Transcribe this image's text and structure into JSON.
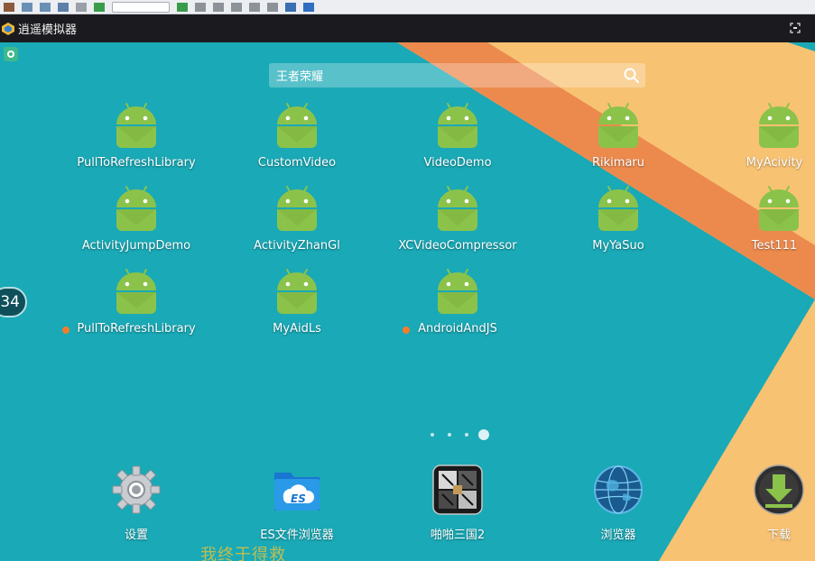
{
  "emulator": {
    "title": "逍遥模拟器",
    "fullscreen_icon": "fullscreen-icon",
    "logo_icon": "emulator-logo-icon"
  },
  "search": {
    "text": "王者荣耀",
    "icon": "search-icon"
  },
  "apps": [
    {
      "label": "PullToRefreshLibrary",
      "new": false
    },
    {
      "label": "CustomVideo",
      "new": false
    },
    {
      "label": "VideoDemo",
      "new": false
    },
    {
      "label": "Rikimaru",
      "new": false
    },
    {
      "label": "MyAcivity",
      "new": false
    },
    {
      "label": "ActivityJumpDemo",
      "new": false
    },
    {
      "label": "ActivityZhanGl",
      "new": false
    },
    {
      "label": "XCVideoCompressor",
      "new": false
    },
    {
      "label": "MyYaSuo",
      "new": false
    },
    {
      "label": "Test111",
      "new": false
    },
    {
      "label": "PullToRefreshLibrary",
      "new": true
    },
    {
      "label": "MyAidLs",
      "new": false
    },
    {
      "label": "AndroidAndJS",
      "new": true
    }
  ],
  "edge_badge": "34",
  "pager": {
    "count": 4,
    "active": 4
  },
  "dock": [
    {
      "label": "设置",
      "icon": "settings-gear-icon"
    },
    {
      "label": "ES文件浏览器",
      "icon": "es-file-explorer-icon"
    },
    {
      "label": "啪啪三国2",
      "icon": "game-papa-sanguo-icon"
    },
    {
      "label": "浏览器",
      "icon": "browser-globe-icon"
    },
    {
      "label": "下载",
      "icon": "download-icon"
    }
  ],
  "overlay_text": "我终于得救",
  "colors": {
    "wallpaper_teal": "#1aa9b6",
    "stripe_orange": "#ec8a4e",
    "stripe_peach": "#f8c273",
    "android_green": "#8bc34a",
    "new_dot": "#f57c2a",
    "titlebar": "#1b1b1f"
  }
}
